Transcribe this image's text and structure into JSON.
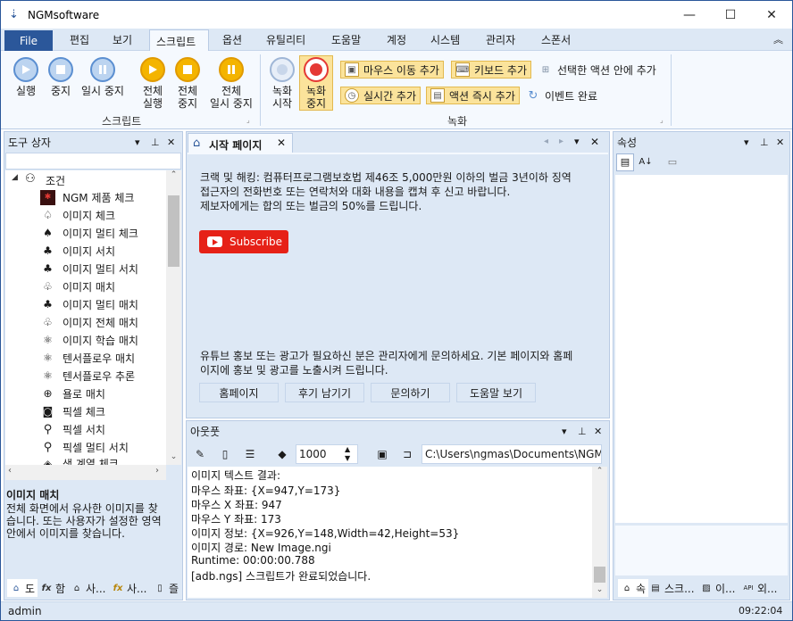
{
  "window": {
    "title": "NGMsoftware",
    "minimize": "—",
    "maximize": "☐",
    "close": "✕"
  },
  "menu": {
    "file": "File",
    "items": [
      "편집",
      "보기",
      "스크립트",
      "옵션",
      "유틸리티",
      "도움말",
      "계정",
      "시스템",
      "관리자",
      "스폰서"
    ],
    "collapse": "︽"
  },
  "ribbon": {
    "script_group": {
      "label": "스크립트",
      "buttons": [
        {
          "label": "실행"
        },
        {
          "label": "중지"
        },
        {
          "label": "일시 중지"
        },
        {
          "label": "전체\n실행"
        },
        {
          "label": "전체\n중지"
        },
        {
          "label": "전체\n일시 중지"
        }
      ]
    },
    "record_group": {
      "label": "녹화",
      "start": "녹화\n시작",
      "stop": "녹화\n중지",
      "mouse_add": "마우스 이동 추가",
      "keyboard_add": "키보드 추가",
      "selected_action": "선택한 액션 안에 추가",
      "realtime_add": "실시간 추가",
      "action_add": "액션 즉시 추가",
      "event_done": "이벤트 완료"
    }
  },
  "toolbox": {
    "title": "도구 상자",
    "root": "조건",
    "items": [
      "NGM 제품 체크",
      "이미지 체크",
      "이미지 멀티 체크",
      "이미지 서치",
      "이미지 멀티 서치",
      "이미지 매치",
      "이미지 멀티 매치",
      "이미지 전체 매치",
      "이미지 학습 매치",
      "텐서플로우 매치",
      "텐서플로우 추론",
      "욜로 매치",
      "픽셀 체크",
      "픽셀 서치",
      "픽셀 멀티 서치",
      "색 계열 체크"
    ],
    "desc_title": "이미지 매치",
    "desc_text": [
      "전체 화면에서 유사한 이미지를 찾",
      "습니다. 또는 사용자가 설정한 영역",
      "안에서 이미지를 찾습니다."
    ],
    "tabs": [
      "도",
      "함",
      "사...",
      "사...",
      "즐"
    ]
  },
  "start_page": {
    "tab": "시작 페이지",
    "warning": [
      "크랙 및 해킹: 컴퓨터프로그램보호법 제46조 5,000만원 이하의 벌금 3년이하 징역",
      "접근자의 전화번호 또는 연락처와 대화 내용을 캡쳐 후 신고 바랍니다.",
      "제보자에게는 합의 또는 벌금의 50%를 드립니다."
    ],
    "subscribe": "Subscribe",
    "promo": [
      "유튜브 홍보 또는 광고가 필요하신 분은 관리자에게 문의하세요. 기본 페이지와 홈페",
      "이지에 홍보 및 광고를 노출시켜 드립니다."
    ],
    "buttons": [
      "홈페이지",
      "후기 남기기",
      "문의하기",
      "도움말 보기"
    ]
  },
  "output": {
    "title": "아웃풋",
    "interval": "1000",
    "path": "C:\\Users\\ngmas\\Documents\\NGM6\\",
    "lines": [
      "이미지 텍스트 결과:",
      "마우스 좌표: {X=947,Y=173}",
      "마우스 X 좌표: 947",
      "마우스 Y 좌표: 173",
      "이미지 정보: {X=926,Y=148,Width=42,Height=53}",
      "이미지 경로: New Image.ngi",
      "Runtime: 00:00:00.788",
      "[adb.ngs] 스크립트가 완료되었습니다."
    ]
  },
  "properties": {
    "title": "속성",
    "tabs": [
      "속",
      "스크...",
      "이...",
      "외..."
    ]
  },
  "status": {
    "user": "admin",
    "time": "09:22:04"
  },
  "colors": {
    "accent": "#2b579a",
    "ribbon_bg": "#f5f9fe",
    "panel_header": "#dde8f5",
    "highlight": "#fbe39b",
    "subscribe_red": "#e62117"
  }
}
